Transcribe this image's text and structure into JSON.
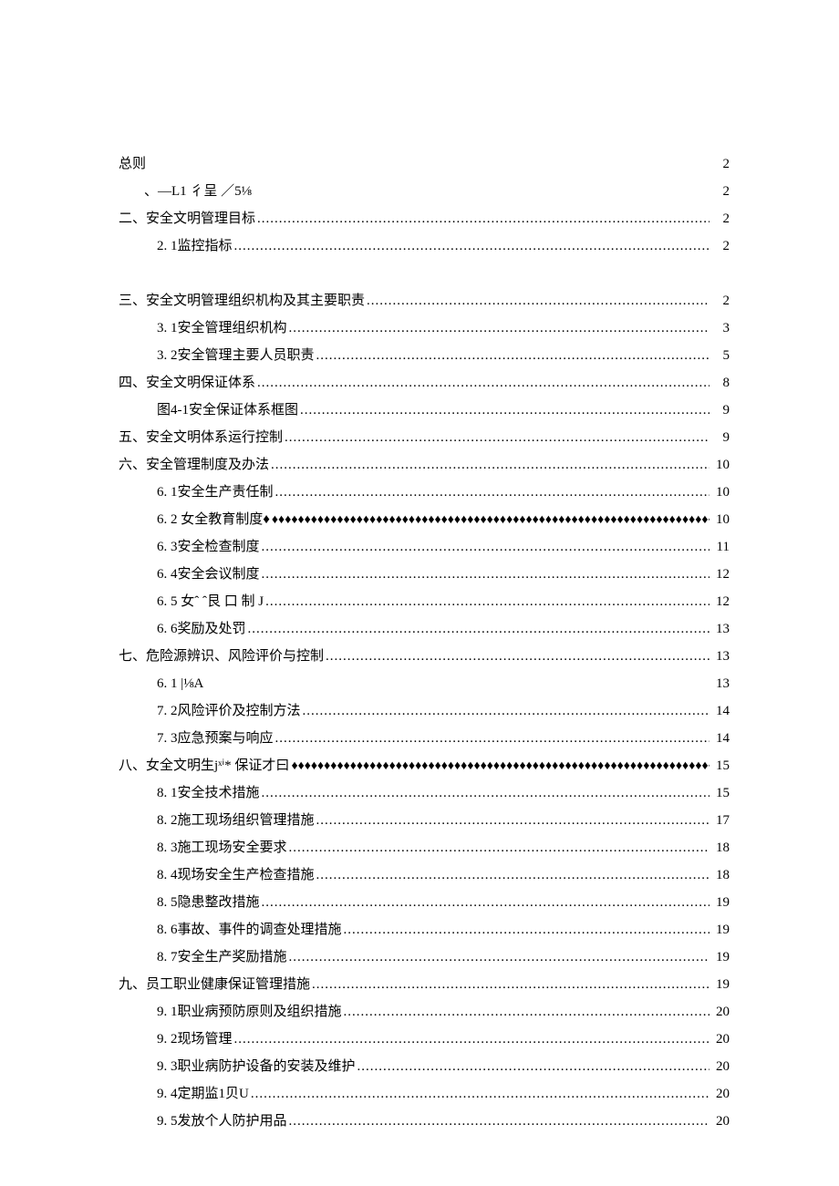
{
  "toc": [
    {
      "indent": 0,
      "label": "总则",
      "leader": "none",
      "page": "2"
    },
    {
      "indent": 1,
      "label": "、—L1 彳呈 ／5⅛",
      "leader": "none",
      "page": "2"
    },
    {
      "indent": 0,
      "label": "二、安全文明管理目标",
      "leader": "dot",
      "page": "2"
    },
    {
      "indent": 2,
      "label": "2. 1监控指标",
      "leader": "dot",
      "page": "2"
    },
    {
      "gap": true
    },
    {
      "indent": 0,
      "label": "三、安全文明管理组织机构及其主要职责",
      "leader": "dot",
      "page": "2"
    },
    {
      "indent": 2,
      "label": "3.  1安全管理组织机构",
      "leader": "dot",
      "page": "3"
    },
    {
      "indent": 2,
      "label": "3.  2安全管理主要人员职责",
      "leader": "dot",
      "page": "5"
    },
    {
      "indent": 0,
      "label": "四、安全文明保证体系",
      "leader": "dot",
      "page": "8"
    },
    {
      "indent": 2,
      "label": "图4-1安全保证体系框图",
      "leader": "dot",
      "page": "9"
    },
    {
      "indent": 0,
      "label": "五、安全文明体系运行控制",
      "leader": "dot",
      "page": "9"
    },
    {
      "indent": 0,
      "label": "六、安全管理制度及办法",
      "leader": "dot",
      "page": "10"
    },
    {
      "indent": 2,
      "label": "6. 1安全生产责任制",
      "leader": "dot",
      "page": "10"
    },
    {
      "indent": 2,
      "label": "6.  2  女全教育制度♦",
      "leader": "diamond",
      "page": " 10"
    },
    {
      "indent": 2,
      "label": "6.  3安全检查制度",
      "leader": "dot",
      "page": "11"
    },
    {
      "indent": 2,
      "label": "6.  4安全会议制度",
      "leader": "dot",
      "page": "12"
    },
    {
      "indent": 2,
      "label": "6. 5 女ˆ ˆ艮 口 制 J ",
      "leader": "dot",
      "page": "12"
    },
    {
      "indent": 2,
      "label": "6.  6奖励及处罚",
      "leader": "dot",
      "page": "13"
    },
    {
      "indent": 0,
      "label": "七、危险源辨识、风险评价与控制",
      "leader": "dot",
      "page": "13"
    },
    {
      "indent": 2,
      "label": "6. 1    |⅛A",
      "leader": "none",
      "page": "13"
    },
    {
      "indent": 2,
      "label": "7.  2风险评价及控制方法",
      "leader": "dot",
      "page": "14"
    },
    {
      "indent": 2,
      "label": "7.  3应急预案与响应",
      "leader": "dot",
      "page": "14"
    },
    {
      "indent": 0,
      "label": "八、女全文明生jˣⁱ*  保证才曰 ",
      "leader": "diamond",
      "page": " 15"
    },
    {
      "indent": 2,
      "label": "8. 1安全技术措施",
      "leader": "dot",
      "page": "15"
    },
    {
      "indent": 2,
      "label": "8.  2施工现场组织管理措施",
      "leader": "dot",
      "page": "17"
    },
    {
      "indent": 2,
      "label": "8.  3施工现场安全要求",
      "leader": "dot",
      "page": "18"
    },
    {
      "indent": 2,
      "label": "8.  4现场安全生产检查措施",
      "leader": "dot",
      "page": "18"
    },
    {
      "indent": 2,
      "label": "8.  5隐患整改措施",
      "leader": "dot",
      "page": "19"
    },
    {
      "indent": 2,
      "label": "8.  6事故、事件的调查处理措施",
      "leader": "dot",
      "page": "19"
    },
    {
      "indent": 2,
      "label": "8.  7安全生产奖励措施",
      "leader": "dot",
      "page": "19"
    },
    {
      "indent": 0,
      "label": "九、员工职业健康保证管理措施",
      "leader": "dot",
      "page": "19"
    },
    {
      "indent": 2,
      "label": "9. 1职业病预防原则及组织措施",
      "leader": "dot",
      "page": "20"
    },
    {
      "indent": 2,
      "label": "9.  2现场管理",
      "leader": "dot",
      "page": "20"
    },
    {
      "indent": 2,
      "label": "9.  3职业病防护设备的安装及维护",
      "leader": "dot",
      "page": "20"
    },
    {
      "indent": 2,
      "label": "9.  4定期监1贝U",
      "leader": "dot",
      "page": "20"
    },
    {
      "indent": 2,
      "label": "9.  5发放个人防护用品",
      "leader": "dot",
      "page": "20"
    }
  ]
}
